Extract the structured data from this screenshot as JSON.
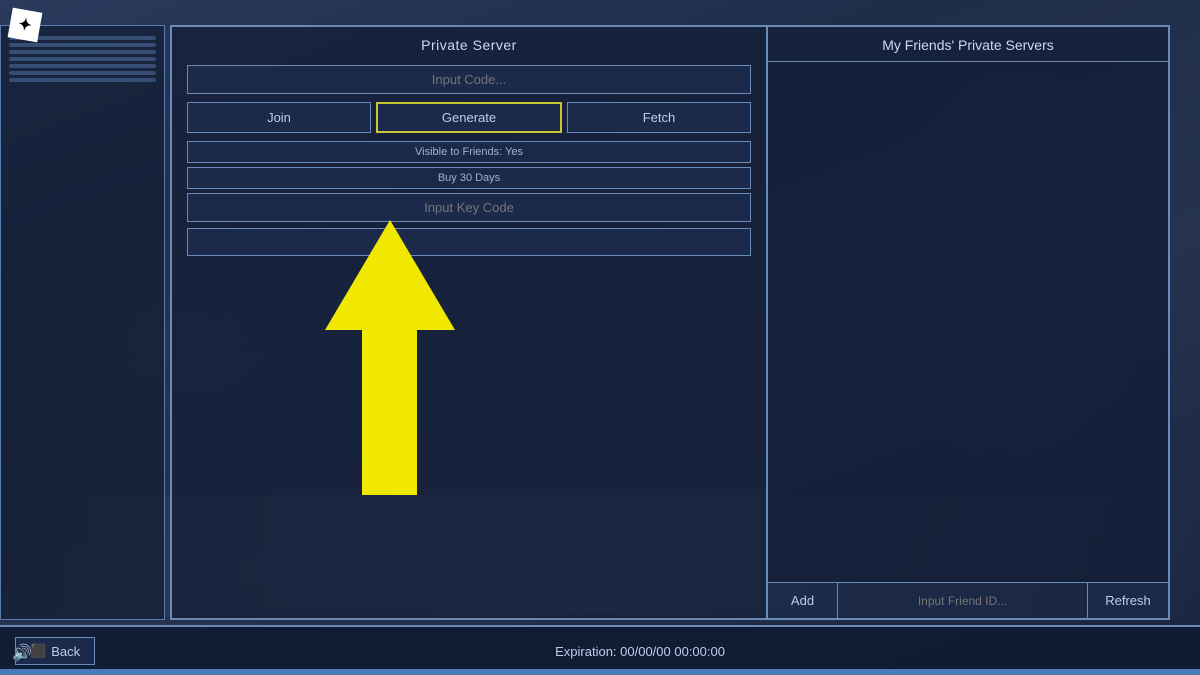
{
  "roblox_icon": "✦",
  "left_panel": {
    "title": "Private Server",
    "input_code_placeholder": "Input Code...",
    "btn_join": "Join",
    "btn_generate": "Generate",
    "btn_fetch": "Fetch",
    "visible_to_friends": "Visible to Friends: Yes",
    "buy_30_days": "Buy 30 Days",
    "input_key_code_placeholder": "Input Key Code",
    "empty_bar": ""
  },
  "right_panel": {
    "title": "My Friends' Private Servers",
    "btn_add": "Add",
    "input_friend_id_placeholder": "Input Friend ID...",
    "btn_refresh": "Refresh"
  },
  "bottom_bar": {
    "btn_back": "Back",
    "expiration": "Expiration: 00/00/00 00:00:00"
  },
  "sound_icon": "🔊",
  "colors": {
    "panel_border": "#6a8ab8",
    "generate_border": "#c8c830",
    "arrow_color": "#f0e800",
    "text_primary": "#d0d8f0",
    "text_secondary": "#a0b0d0"
  }
}
